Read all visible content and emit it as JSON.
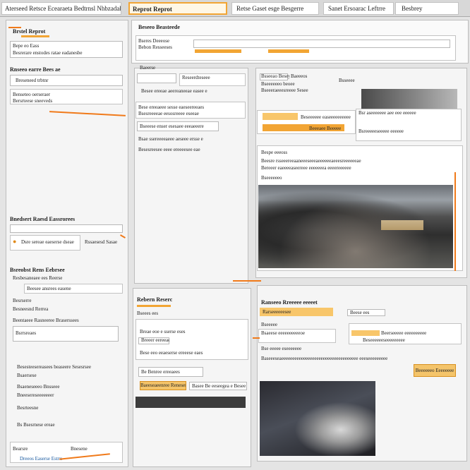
{
  "tabs": {
    "main": "Aterseed Retsce Ecearaeta Bedtrnsl Nhbzadah",
    "report": "Reprot Reprot",
    "search": "Retse Gaset esge Besgerre",
    "sub": "Sanet Ersoarac Leftrre",
    "history": "Besbrey"
  },
  "left": {
    "section1_title": "Brstel Reprot",
    "section1_line1": "Bepe eo Eass",
    "section1_line2": "Besrerare enstodes ratae eadanesbe",
    "section2_title": "Rnseeo earre Bees ae",
    "section2_line1": "Breseneed trbtnr",
    "section2_line2": "Benseteo oerseraer",
    "section2_line3": "Bersrteese sneeveds",
    "section3_title": "Bnedsert Raesd Eassrorees",
    "section3_line1": "Dsre sereae eaeserse dseae",
    "section3_line2": "Rssaesesd Sasae",
    "section4_title": "Bsreobst Rens Eebrsee",
    "section4_line1": "Resbesaneaee ees Reerse",
    "section4_line2": "Beesee ansrees easene",
    "section4_line3": "Besrserre",
    "section4_line4": "Besneesnd Rerrea",
    "section4_line5": "Beentaeee Rasneeree Braserssees",
    "section4_line6": "Bsrrsreaes",
    "section5_line1": "Besesteesereasees beaseere Sesesrsee",
    "section5_line2": "Bsaersese",
    "section5_line3": "Bsaeneseeeo Bnsseee",
    "section5_line4": "Bneesereseeeeeeer",
    "section5_line5": "Besrteesne",
    "section5_line6": "Bs Bsesrnese ereae",
    "section6_line1": "Bearsre",
    "section6_line2": "Bnesene",
    "section6_line3": "Dreeos Easerse Estrrs"
  },
  "middle": {
    "header": "Beseeo Beasteede",
    "box1_line1": "Bseres Deeeose",
    "box1_line2": "Bebon Resseeses",
    "field_label": "Baeerse",
    "r1": "Reseerdteseee",
    "r2": "Besee ereeae aeereaneeae easee e",
    "r3": "Bese ereeaeee sesse eaeseereeaes",
    "r4": "Bsesreeeeae eesosreeee eseeae",
    "r5": "Bseeese enser esesaee eeeaeeere",
    "r6": "Bsae ssereeeeaeee aeseee ersse e",
    "r7": "Besesreesee eeee ereeeesee eae",
    "section_title": "Rebern Reserc",
    "s1": "Breae eoe e sserse eses",
    "s2": "Breeer eereeaea",
    "s3": "Bseees ees",
    "s4": "Bese eeo eeaeserse ereeese eaes",
    "s5": "Be Benree ereeaees",
    "btn1": "Baeeseaeenree Renesene",
    "btn2": "Basee Be eeseegea e Besee"
  },
  "right": {
    "field1": "Bsseeao Besey",
    "field2": "Baeeeos",
    "line1": "Bseeeeeeo beoee",
    "line2": "Bseeeraeeesreeee Sesee",
    "line3": "Bsseeee",
    "card_line1": "Bsr aseeeeeee aee eee eeeeee",
    "card_line2": "Beseeeeee easeeeeeeeeee",
    "card_btn": "Beeeaee Beeeee",
    "card_line3": "Bsreeeeeseeeee eeeeee",
    "card_sub": "Bespe eeeoss",
    "desc1": "Beesre rsseeereeaaneeeseeeaeeeeeeaeeesreeeeeeae",
    "desc2": "Bereeer eaeeeeaseereee eeeeeeea eeeereeeeee",
    "desc3": "Bseeeeeeo",
    "lower_title": "Ranseeo Rreeeee eeeeet",
    "lower_tag": "Rarseeeeeesee",
    "lower_tag2": "Beese ees",
    "lower_l1": "Bseeeee",
    "lower_l2": "Bsaeese eeeeeeeeeeoe",
    "lower_l3": "Bse eeeee eseeeeeee",
    "lower_card1": "Beerseeeee eeeeeeeeee",
    "lower_card2": "Beseeeeeeseeeeeeeee",
    "lower_desc": "Baseeeseaeeeeeeeeeeeeeeeeeeeeeeeeeeeeeeeeeee eeeseeeeeeeee",
    "lower_btn": "Beeeeeeo Eeeeeeee"
  },
  "colors": {
    "accent": "#f2a534",
    "arrow": "#f07a1a"
  }
}
